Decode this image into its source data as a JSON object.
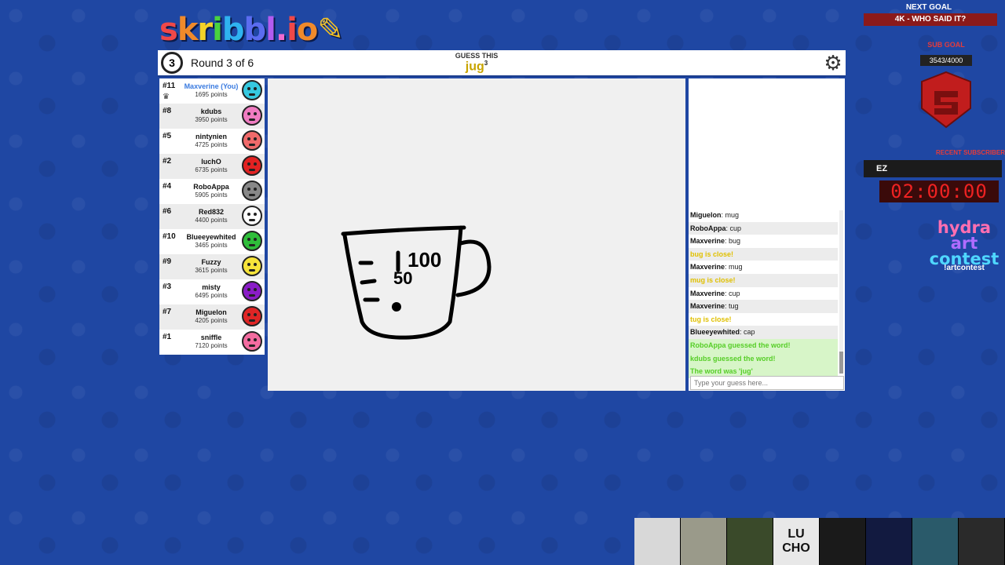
{
  "logo": {
    "text": "skribbl.io"
  },
  "header": {
    "clock_value": "3",
    "round_text": "Round 3 of 6",
    "guess_label": "GUESS THIS",
    "word": "jug",
    "word_length": "3"
  },
  "players": [
    {
      "rank": "#11",
      "name": "Maxverine (You)",
      "points": "1695 points",
      "color": "#36c9e0",
      "you": true
    },
    {
      "rank": "#8",
      "name": "kdubs",
      "points": "3950 points",
      "color": "#f07cc1"
    },
    {
      "rank": "#5",
      "name": "nintynien",
      "points": "4725 points",
      "color": "#f06a6a"
    },
    {
      "rank": "#2",
      "name": "luchO",
      "points": "6735 points",
      "color": "#e22222"
    },
    {
      "rank": "#4",
      "name": "RoboAppa",
      "points": "5905 points",
      "color": "#888888"
    },
    {
      "rank": "#6",
      "name": "Red832",
      "points": "4400 points",
      "color": "#ffffff"
    },
    {
      "rank": "#10",
      "name": "Blueeyewhited",
      "points": "3465 points",
      "color": "#2fbe3a"
    },
    {
      "rank": "#9",
      "name": "Fuzzy",
      "points": "3615 points",
      "color": "#f7e43a"
    },
    {
      "rank": "#3",
      "name": "misty",
      "points": "6495 points",
      "color": "#8a1cc7"
    },
    {
      "rank": "#7",
      "name": "Miguelon",
      "points": "4205 points",
      "color": "#e02525"
    },
    {
      "rank": "#1",
      "name": "sniffle",
      "points": "7120 points",
      "color": "#f36ca0"
    }
  ],
  "drawing": {
    "text1": "100",
    "text2": "50"
  },
  "chat": {
    "messages": [
      {
        "user": "Miguelon",
        "text": "mug",
        "kind": "normal"
      },
      {
        "user": "RoboAppa",
        "text": "cup",
        "kind": "normal"
      },
      {
        "user": "Maxverine",
        "text": "bug",
        "kind": "normal"
      },
      {
        "user": "",
        "text": "bug is close!",
        "kind": "close"
      },
      {
        "user": "Maxverine",
        "text": "mug",
        "kind": "normal"
      },
      {
        "user": "",
        "text": "mug is close!",
        "kind": "close"
      },
      {
        "user": "Maxverine",
        "text": "cup",
        "kind": "normal"
      },
      {
        "user": "Maxverine",
        "text": "tug",
        "kind": "normal"
      },
      {
        "user": "",
        "text": "tug is close!",
        "kind": "close"
      },
      {
        "user": "Blueeyewhited",
        "text": "cap",
        "kind": "normal"
      },
      {
        "user": "",
        "text": "RoboAppa guessed the word!",
        "kind": "correct"
      },
      {
        "user": "",
        "text": "kdubs guessed the word!",
        "kind": "correct"
      },
      {
        "user": "",
        "text": "The word was 'jug'",
        "kind": "correct"
      }
    ],
    "input_placeholder": "Type your guess here..."
  },
  "overlay": {
    "next_goal_label": "NEXT GOAL",
    "next_goal_value": "4K - WHO SAID IT?",
    "sub_goal_label": "SUB GOAL",
    "sub_goal_value": "3543/4000",
    "recent_sub_label": "RECENT SUBSCRIBER",
    "recent_sub_name": "EZ",
    "timer": "02:00:00",
    "contest_line1": "hydra",
    "contest_line2": "art",
    "contest_line3": "contest",
    "contest_cmd": "!artcontest"
  },
  "strip": {
    "lucho_line1": "LU",
    "lucho_line2": "CHO"
  }
}
